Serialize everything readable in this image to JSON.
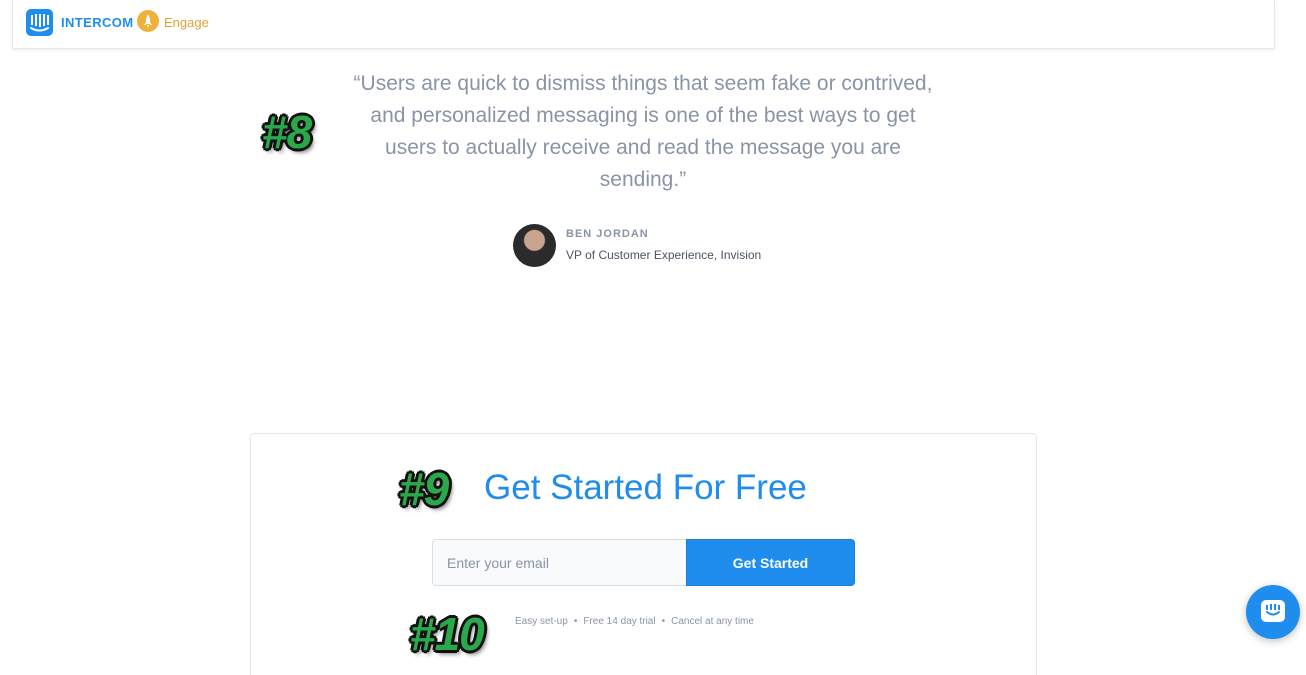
{
  "header": {
    "brand": "INTERCOM",
    "product": "Engage"
  },
  "annotations": {
    "tag_8": "#8",
    "tag_9": "#9",
    "tag_10": "#10"
  },
  "testimonial": {
    "quote": "“Users are quick to dismiss things that seem fake or contrived, and personalized messaging is one of the best ways to get users to actually receive and read the message you are sending.”",
    "author_name": "BEN JORDAN",
    "author_role": "VP of Customer Experience, Invision"
  },
  "signup": {
    "title": "Get Started For Free",
    "email_placeholder": "Enter your email",
    "button_label": "Get Started",
    "perks": [
      "Easy set-up",
      "Free 14 day trial",
      "Cancel at any time"
    ]
  },
  "colors": {
    "brand_blue": "#1f8ded",
    "engage_orange": "#f0b13b",
    "annotation_green": "#2aa84b"
  },
  "icons": {
    "logo": "intercom-logo-icon",
    "engage": "rocket-icon",
    "chat": "chat-launcher-icon"
  }
}
